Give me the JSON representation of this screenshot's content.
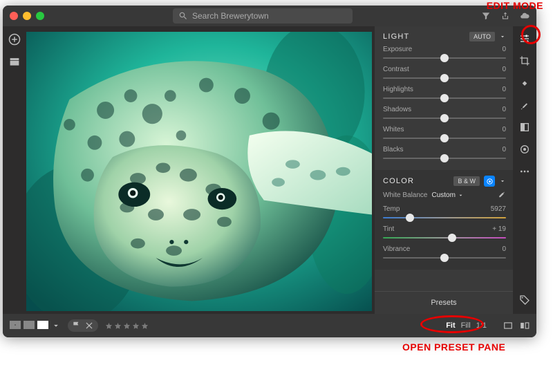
{
  "search": {
    "placeholder": "Search Brewerytown"
  },
  "panel": {
    "light": {
      "title": "LIGHT",
      "auto": "AUTO",
      "sliders": [
        {
          "label": "Exposure",
          "value": "0",
          "pos": 50
        },
        {
          "label": "Contrast",
          "value": "0",
          "pos": 50
        },
        {
          "label": "Highlights",
          "value": "0",
          "pos": 50
        },
        {
          "label": "Shadows",
          "value": "0",
          "pos": 50
        },
        {
          "label": "Whites",
          "value": "0",
          "pos": 50
        },
        {
          "label": "Blacks",
          "value": "0",
          "pos": 50
        }
      ]
    },
    "color": {
      "title": "COLOR",
      "bw": "B & W",
      "wb_label": "White Balance",
      "wb_value": "Custom",
      "sliders": [
        {
          "label": "Temp",
          "value": "5927",
          "pos": 22,
          "track": "temp"
        },
        {
          "label": "Tint",
          "value": "+ 19",
          "pos": 56,
          "track": "tint"
        },
        {
          "label": "Vibrance",
          "value": "0",
          "pos": 50,
          "track": ""
        }
      ]
    },
    "presets": "Presets"
  },
  "footer": {
    "zoom": {
      "fit": "Fit",
      "fill": "Fill",
      "z11": "1:1"
    }
  },
  "annotations": {
    "edit_mode": "EDIT MODE",
    "open_preset": "OPEN PRESET PANE"
  }
}
